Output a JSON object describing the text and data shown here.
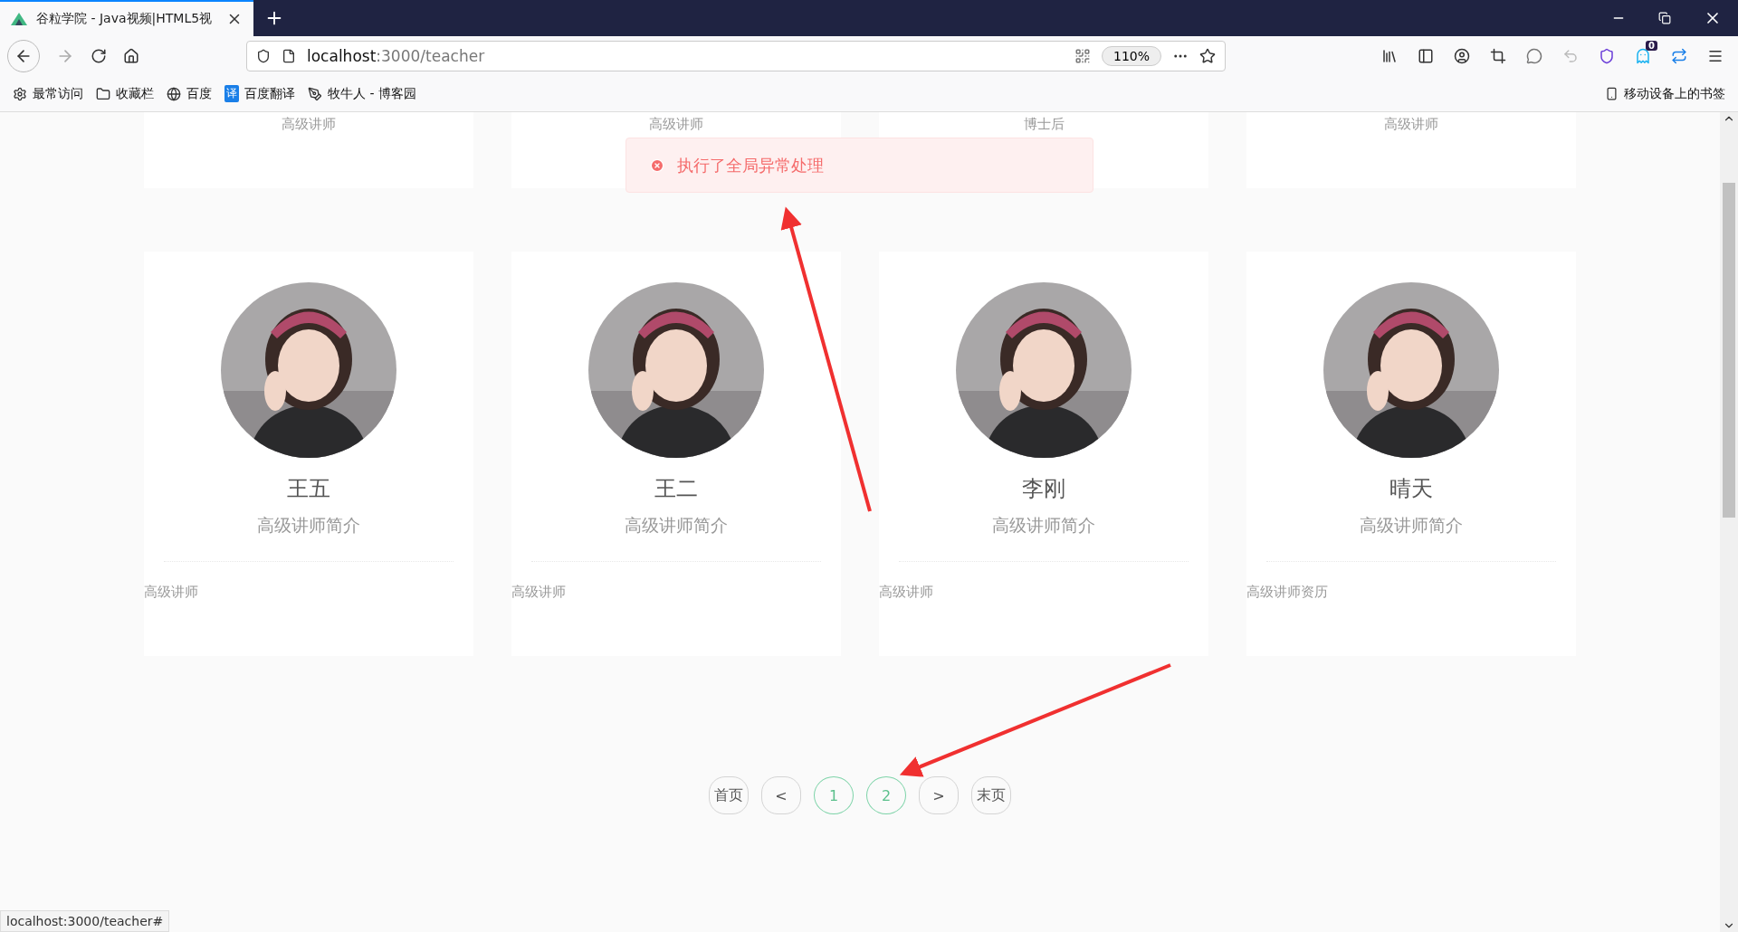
{
  "browser": {
    "tab_title": "谷粒学院 - Java视频|HTML5视",
    "url_host": "localhost",
    "url_rest": ":3000/teacher",
    "zoom": "110%",
    "notification_count": "0",
    "bookmarks": [
      {
        "label": "最常访问",
        "kind": "gear"
      },
      {
        "label": "收藏栏",
        "kind": "folder"
      },
      {
        "label": "百度",
        "kind": "globe"
      },
      {
        "label": "百度翻译",
        "kind": "translate",
        "icon_text": "译"
      },
      {
        "label": "牧牛人 - 博客园",
        "kind": "blog"
      }
    ],
    "mobile_bookmarks": "移动设备上的书签"
  },
  "top_row": [
    {
      "title": "高级讲师"
    },
    {
      "title": "高级讲师"
    },
    {
      "title": "博士后"
    },
    {
      "title": "高级讲师"
    }
  ],
  "teachers": [
    {
      "name": "王五",
      "intro": "高级讲师简介",
      "title": "高级讲师"
    },
    {
      "name": "王二",
      "intro": "高级讲师简介",
      "title": "高级讲师"
    },
    {
      "name": "李刚",
      "intro": "高级讲师简介",
      "title": "高级讲师"
    },
    {
      "name": "晴天",
      "intro": "高级讲师简介",
      "title": "高级讲师资历"
    }
  ],
  "toast": {
    "kind": "error",
    "message": "执行了全局异常处理"
  },
  "pagination": [
    {
      "label": "首页",
      "kind": "nav"
    },
    {
      "label": "<",
      "kind": "nav"
    },
    {
      "label": "1",
      "kind": "page"
    },
    {
      "label": "2",
      "kind": "page"
    },
    {
      "label": ">",
      "kind": "nav"
    },
    {
      "label": "末页",
      "kind": "nav"
    }
  ],
  "status_bar": "localhost:3000/teacher#"
}
